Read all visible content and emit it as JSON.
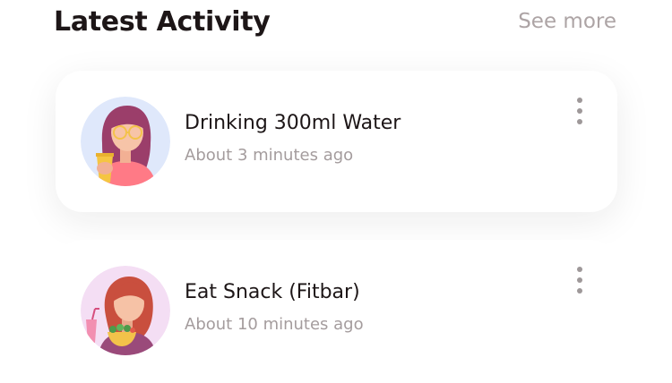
{
  "section": {
    "title": "Latest Activity",
    "see_more": "See more"
  },
  "activities": [
    {
      "title": "Drinking 300ml Water",
      "time": "About 3 minutes ago",
      "avatar_icon": "woman-drinking-water-avatar",
      "avatar_bg": "#dfe8fb",
      "menu_icon": "more-vertical-icon"
    },
    {
      "title": "Eat Snack (Fitbar)",
      "time": "About 10 minutes ago",
      "avatar_icon": "woman-eating-snack-avatar",
      "avatar_bg": "#f4def4",
      "menu_icon": "more-vertical-icon"
    }
  ],
  "colors": {
    "title_text": "#1d1617",
    "muted_text": "#ada4a5",
    "card_bg": "#ffffff",
    "menu_dots": "#9e9899"
  }
}
